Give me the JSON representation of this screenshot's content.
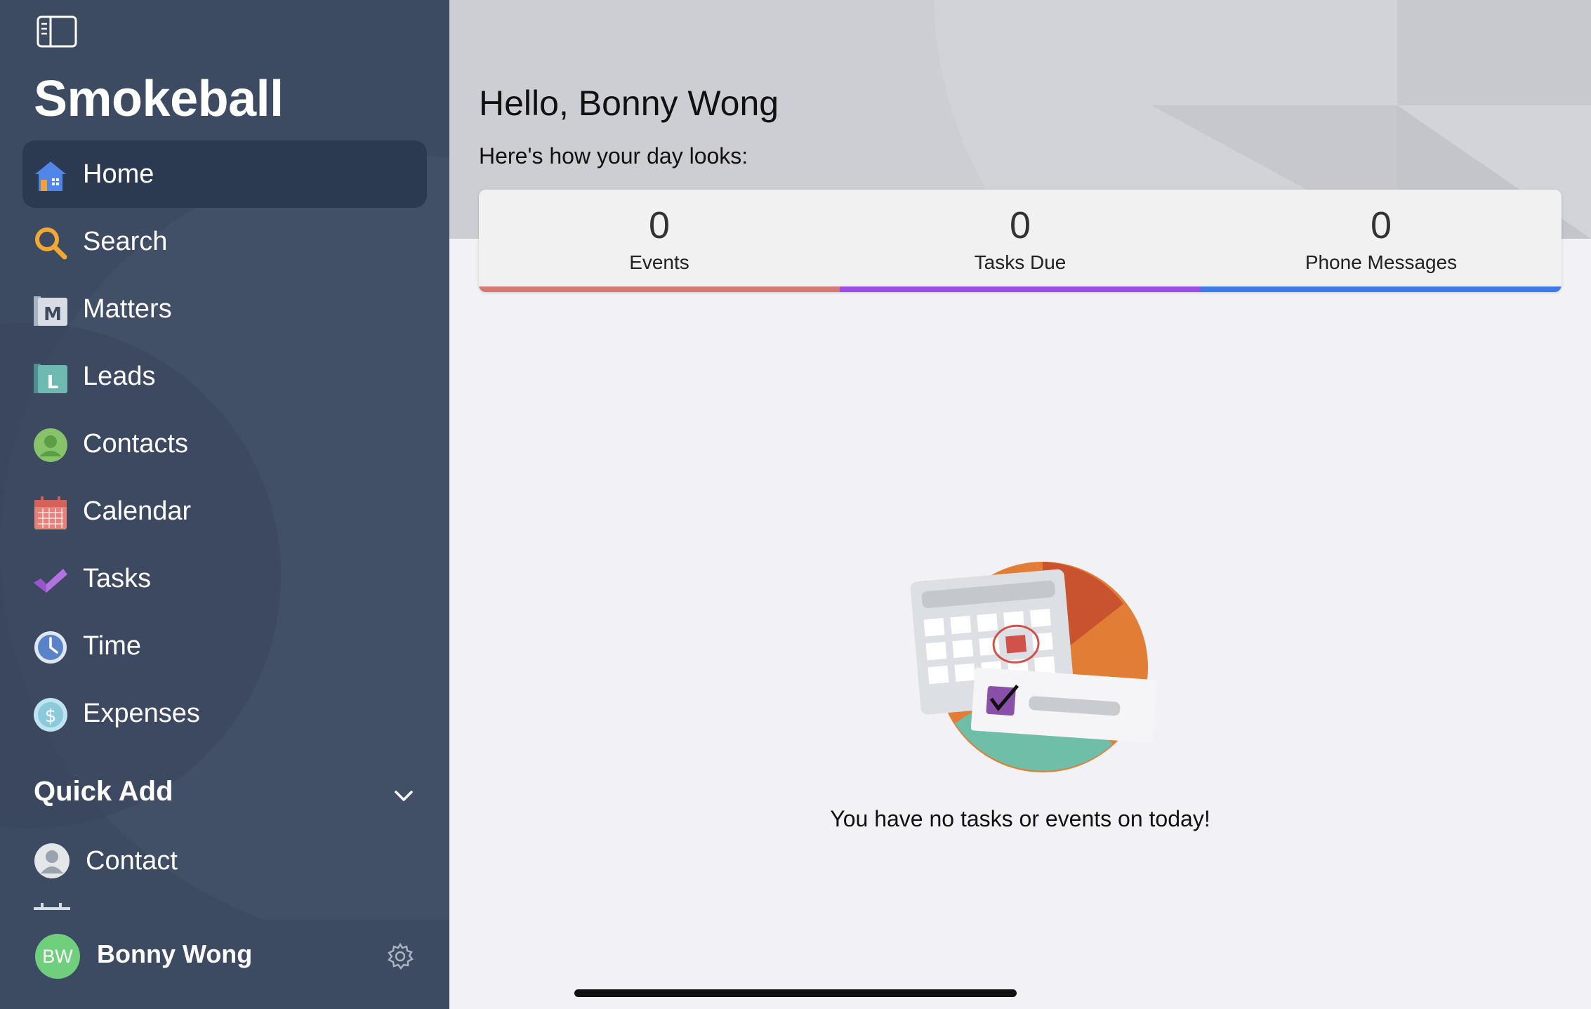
{
  "app": {
    "brand": "Smokeball"
  },
  "sidebar": {
    "items": [
      {
        "label": "Home",
        "icon": "home-icon",
        "active": true
      },
      {
        "label": "Search",
        "icon": "search-icon",
        "active": false
      },
      {
        "label": "Matters",
        "icon": "matters-icon",
        "active": false
      },
      {
        "label": "Leads",
        "icon": "leads-icon",
        "active": false
      },
      {
        "label": "Contacts",
        "icon": "contacts-icon",
        "active": false
      },
      {
        "label": "Calendar",
        "icon": "calendar-icon",
        "active": false
      },
      {
        "label": "Tasks",
        "icon": "tasks-icon",
        "active": false
      },
      {
        "label": "Time",
        "icon": "clock-icon",
        "active": false
      },
      {
        "label": "Expenses",
        "icon": "dollar-icon",
        "active": false
      }
    ],
    "quick_add": {
      "title": "Quick Add",
      "items": [
        {
          "label": "Contact",
          "icon": "person-icon"
        }
      ]
    },
    "user": {
      "initials": "BW",
      "name": "Bonny Wong"
    }
  },
  "main": {
    "greeting": "Hello, Bonny Wong",
    "subgreeting": "Here's how your day looks:",
    "stats": [
      {
        "value": "0",
        "label": "Events",
        "color": "#d47a72"
      },
      {
        "value": "0",
        "label": "Tasks Due",
        "color": "#9b4de6"
      },
      {
        "value": "0",
        "label": "Phone Messages",
        "color": "#3d7be6"
      }
    ],
    "empty_message": "You have no tasks or events on today!"
  },
  "colors": {
    "sidebar_bg": "#3c4a62",
    "active_item_bg": "#2c3a51",
    "avatar_bg": "#6fcf7c"
  }
}
